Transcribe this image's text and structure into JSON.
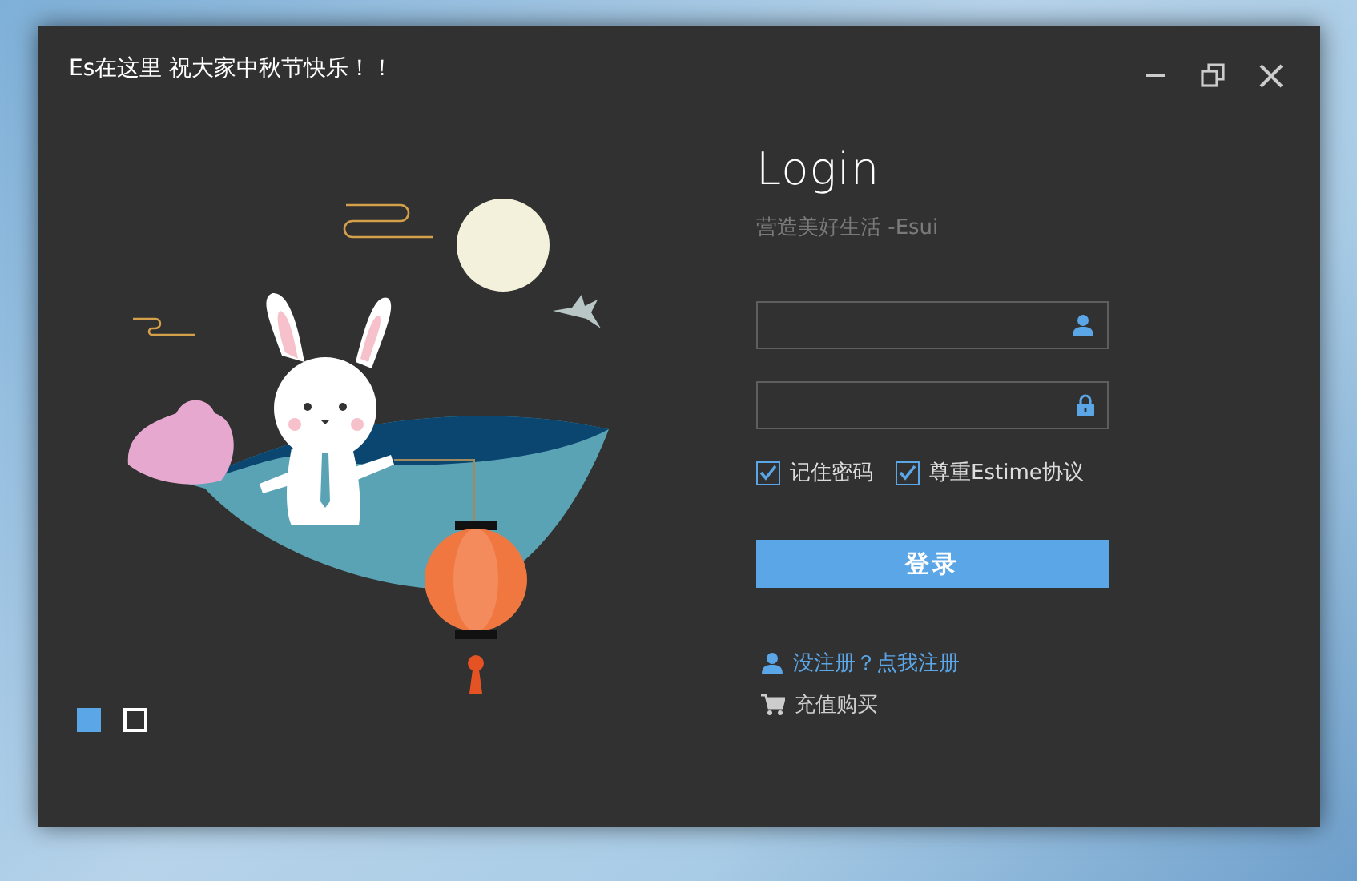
{
  "window": {
    "title": "Es在这里 祝大家中秋节快乐！！"
  },
  "login": {
    "heading": "Login",
    "subtitle": "营造美好生活 -Esui",
    "fields": [
      {
        "kind": "user"
      },
      {
        "kind": "lock"
      }
    ],
    "options": [
      {
        "label": "记住密码",
        "checked": true
      },
      {
        "label": "尊重Estime协议",
        "checked": true
      }
    ],
    "submit": "登录",
    "links": [
      {
        "kind": "register",
        "label": "没注册？点我注册"
      },
      {
        "kind": "purchase",
        "label": "充值购买"
      }
    ]
  },
  "slides": [
    {
      "selected": true
    },
    {
      "selected": false
    }
  ]
}
